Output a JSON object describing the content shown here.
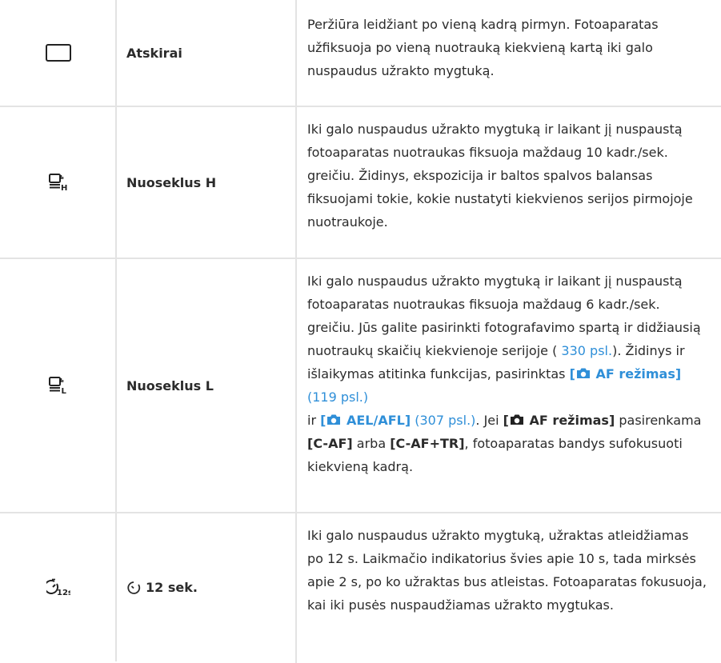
{
  "rows": [
    {
      "name": "Atskirai",
      "icon": "single-frame-icon",
      "desc": "Peržiūra leidžiant po vieną kadrą pirmyn. Fotoaparatas užfiksuoja po vieną nuotrauką kiekvieną kartą iki galo nuspaudus užrakto mygtuką."
    },
    {
      "name": "Nuoseklus H",
      "icon": "sequential-h-icon",
      "desc": "Iki galo nuspaudus užrakto mygtuką ir laikant jį nuspaustą fotoaparatas nuotraukas fiksuoja maždaug 10 kadr./sek. greičiu. Židinys, ekspozicija ir baltos spalvos balansas fiksuojami tokie, kokie nustatyti kiekvienos serijos pirmojoje nuotraukoje."
    },
    {
      "name": "Nuoseklus L",
      "icon": "sequential-l-icon",
      "desc_a": "Iki galo nuspaudus užrakto mygtuką ir laikant jį nuspaustą fotoaparatas nuotraukas fiksuoja maždaug 6 kadr./sek. greičiu. Jūs galite pasirinkti fotografavimo spartą ir didžiausią nuotraukų skaičių kiekvienoje serijoje (",
      "link_1": " 330 psl.",
      "desc_b": "). Židinys ir išlaikymas atitinka funkcijas, pasirinktas ",
      "ref_af_a": "[",
      "ref_af_b": " AF režimas]",
      "link_2": " (119 psl.)",
      "desc_c": "ir ",
      "ref_ael_a": "[",
      "ref_ael_b": " AEL/AFL]",
      "link_3": " (307 psl.)",
      "desc_d": ". Jei ",
      "ref_af2_a": "[",
      "ref_af2_b": " AF režimas]",
      "desc_e": " pasirenkama ",
      "opt_caf": "[C-AF]",
      "desc_f": " arba ",
      "opt_caftr": "[C-AF+TR]",
      "desc_g": ", fotoaparatas bandys sufokusuoti kiekvieną kadrą."
    },
    {
      "name": "12 sek.",
      "icon": "self-timer-12s-icon",
      "desc": "Iki galo nuspaudus užrakto mygtuką, užraktas atleidžiamas po 12 s. Laikmačio indikatorius švies apie 10 s, tada mirksės apie 2 s, po ko užraktas bus atleistas. Fotoaparatas fokusuoja, kai iki pusės nuspaudžiamas užrakto mygtukas."
    }
  ]
}
